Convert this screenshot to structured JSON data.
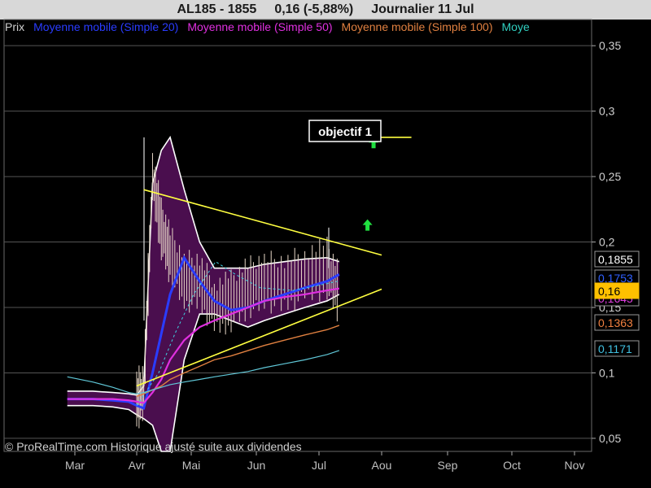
{
  "header": {
    "symbol": "AL185 - 1855",
    "price_change": "0,16 (-5,88%)",
    "period": "Journalier  11 Jul"
  },
  "legend": [
    {
      "label": "Prix",
      "color": "#d0d0d0"
    },
    {
      "label": "Moyenne mobile (Simple 20)",
      "color": "#2a3cff"
    },
    {
      "label": "Moyenne mobile (Simple 50)",
      "color": "#e030e0"
    },
    {
      "label": "Moyenne mobile (Simple 100)",
      "color": "#e08040"
    },
    {
      "label": "Moye",
      "color": "#30d0c0"
    }
  ],
  "annotation": {
    "objective_label": "objectif 1"
  },
  "price_tags": [
    {
      "text": "0,1855",
      "color": "#ffffff",
      "bg": "#000000",
      "value": 0.1855
    },
    {
      "text": "0,1753",
      "color": "#3060ff",
      "bg": "#000000",
      "value": 0.1753
    },
    {
      "text": "0,1645",
      "color": "#e040e0",
      "bg": "#000000",
      "value": 0.1645
    },
    {
      "text": "0,16",
      "color": "#000000",
      "bg": "#ffc000",
      "value": 0.16
    },
    {
      "text": "0,1363",
      "color": "#f08040",
      "bg": "#000000",
      "value": 0.1363
    },
    {
      "text": "0,1171",
      "color": "#40c0e0",
      "bg": "#000000",
      "value": 0.1171
    }
  ],
  "copyright": "© ProRealTime.com Historique ajusté suite aux dividendes",
  "chart_data": {
    "type": "line",
    "title": "AL185 - 1855   0,16 (-5,88%)   Journalier 11 Jul",
    "x_ticks": [
      "Mar",
      "Avr",
      "Mai",
      "Jun",
      "Jul",
      "Aou",
      "Sep",
      "Oct",
      "Nov"
    ],
    "y_ticks": [
      "0,05",
      "0,1",
      "0,15",
      "0,2",
      "0,25",
      "0,3",
      "0,35"
    ],
    "ylim": [
      0.04,
      0.37
    ],
    "grid": true,
    "legend_position": "top",
    "x": [
      "Feb-28",
      "Mar-10",
      "Mar-20",
      "Mar-28",
      "Apr-01",
      "Apr-05",
      "Apr-10",
      "Apr-15",
      "Apr-20",
      "Apr-28",
      "May-05",
      "May-12",
      "May-20",
      "May-28",
      "Jun-05",
      "Jun-15",
      "Jun-25",
      "Jul-05",
      "Jul-11"
    ],
    "series": [
      {
        "name": "Prix",
        "values": [
          0.082,
          0.082,
          0.081,
          0.08,
          0.08,
          0.085,
          0.25,
          0.21,
          0.19,
          0.17,
          0.17,
          0.15,
          0.155,
          0.165,
          0.17,
          0.168,
          0.175,
          0.18,
          0.16
        ]
      },
      {
        "name": "Moyenne mobile (Simple 20)",
        "values": [
          0.08,
          0.08,
          0.079,
          0.078,
          0.075,
          0.073,
          0.1,
          0.13,
          0.16,
          0.188,
          0.17,
          0.155,
          0.148,
          0.15,
          0.155,
          0.16,
          0.165,
          0.17,
          0.1753
        ]
      },
      {
        "name": "Moyenne mobile (Simple 50)",
        "values": [
          0.08,
          0.08,
          0.08,
          0.079,
          0.078,
          0.077,
          0.085,
          0.095,
          0.11,
          0.125,
          0.135,
          0.14,
          0.145,
          0.15,
          0.155,
          0.158,
          0.16,
          0.163,
          0.1645
        ]
      },
      {
        "name": "Moyenne mobile (Simple 100)",
        "values": [
          null,
          null,
          null,
          null,
          0.082,
          0.084,
          0.087,
          0.09,
          0.095,
          0.1,
          0.105,
          0.11,
          0.113,
          0.117,
          0.121,
          0.125,
          0.129,
          0.133,
          0.1363
        ]
      },
      {
        "name": "Moye",
        "values": [
          0.097,
          0.093,
          0.089,
          0.085,
          0.084,
          0.085,
          0.087,
          0.089,
          0.091,
          0.093,
          0.095,
          0.097,
          0.099,
          0.101,
          0.104,
          0.107,
          0.11,
          0.114,
          0.1171
        ]
      }
    ],
    "envelope_upper": [
      0.086,
      0.086,
      0.085,
      0.084,
      0.083,
      0.09,
      0.245,
      0.27,
      0.28,
      0.24,
      0.2,
      0.18,
      0.18,
      0.18,
      0.183,
      0.185,
      0.187,
      0.188,
      0.185
    ],
    "envelope_lower": [
      0.075,
      0.075,
      0.074,
      0.072,
      0.068,
      0.065,
      0.06,
      0.04,
      0.04,
      0.11,
      0.145,
      0.145,
      0.14,
      0.135,
      0.14,
      0.145,
      0.15,
      0.155,
      0.16
    ],
    "trendlines": [
      {
        "from": [
          "Apr-05",
          0.24
        ],
        "to": [
          "Aug-01",
          0.19
        ]
      },
      {
        "from": [
          "Apr-01",
          0.09
        ],
        "to": [
          "Aug-01",
          0.164
        ]
      },
      {
        "from": [
          "Jul-15",
          0.28
        ],
        "to": [
          "Aug-15",
          0.28
        ]
      }
    ],
    "arrows": [
      {
        "x": "Jul-28",
        "y": 0.276,
        "direction": "up"
      },
      {
        "x": "Jul-25",
        "y": 0.213,
        "direction": "up"
      }
    ]
  }
}
